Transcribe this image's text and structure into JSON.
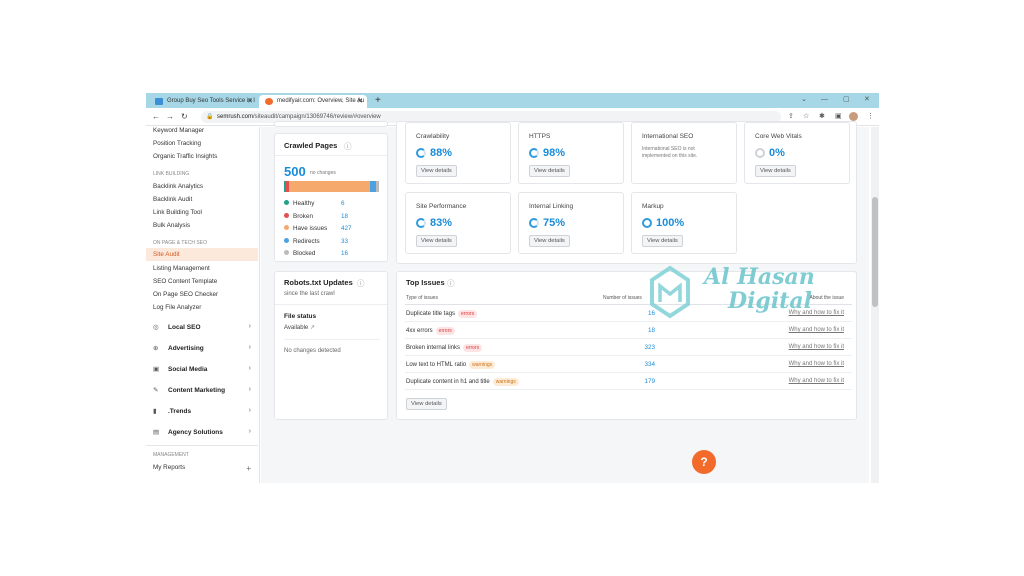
{
  "browser": {
    "tabs": [
      {
        "label": "Group Buy Seo Tools Service in I",
        "close": "✕"
      },
      {
        "label": "medifyair.com: Overview, Site Au",
        "close": "✕"
      }
    ],
    "new_tab": "+",
    "url_domain": "semrush.com",
    "url_path": "/siteaudit/campaign/13069746/review/#overview",
    "window_controls": [
      "⌄",
      "—",
      "▢",
      "✕"
    ]
  },
  "sidebar": {
    "top_items": [
      "Keyword Manager",
      "Position Tracking",
      "Organic Traffic Insights"
    ],
    "link_building_heading": "LINK BUILDING",
    "link_building_items": [
      "Backlink Analytics",
      "Backlink Audit",
      "Link Building Tool",
      "Bulk Analysis"
    ],
    "onpage_heading": "ON PAGE & TECH SEO",
    "onpage_items": [
      "Site Audit",
      "Listing Management",
      "SEO Content Template",
      "On Page SEO Checker",
      "Log File Analyzer"
    ],
    "groups": [
      {
        "label": "Local SEO",
        "icon": "pin-icon"
      },
      {
        "label": "Advertising",
        "icon": "target-icon"
      },
      {
        "label": "Social Media",
        "icon": "social-icon"
      },
      {
        "label": "Content Marketing",
        "icon": "pen-icon"
      },
      {
        "label": ".Trends",
        "icon": "bars-icon"
      },
      {
        "label": "Agency Solutions",
        "icon": "doc-icon"
      }
    ],
    "management_heading": "MANAGEMENT",
    "my_reports": "My Reports",
    "my_reports_add": "+"
  },
  "crawled": {
    "title": "Crawled Pages",
    "count": "500",
    "count_note": "no changes",
    "legend": [
      {
        "label": "Healthy",
        "value": "6",
        "color": "#23a08c"
      },
      {
        "label": "Broken",
        "value": "18",
        "color": "#e25050"
      },
      {
        "label": "Have issues",
        "value": "427",
        "color": "#f6a96c"
      },
      {
        "label": "Redirects",
        "value": "33",
        "color": "#4aa3e0"
      },
      {
        "label": "Blocked",
        "value": "16",
        "color": "#bbbbbb"
      }
    ]
  },
  "robots": {
    "title": "Robots.txt Updates",
    "subtitle": "since the last crawl",
    "file_status_label": "File status",
    "file_status_value": "Available",
    "changes": "No changes detected"
  },
  "metrics": [
    {
      "title": "Crawlability",
      "value": "88%",
      "button": "View details",
      "progress": 0.88
    },
    {
      "title": "HTTPS",
      "value": "98%",
      "button": "View details",
      "progress": 0.98
    },
    {
      "title": "International SEO",
      "note": "International SEO is not implemented on this site."
    },
    {
      "title": "Core Web Vitals",
      "value": "0%",
      "button": "View details",
      "progress": 0
    },
    {
      "title": "Site Performance",
      "value": "83%",
      "button": "View details",
      "progress": 0.83
    },
    {
      "title": "Internal Linking",
      "value": "75%",
      "button": "View details",
      "progress": 0.75
    },
    {
      "title": "Markup",
      "value": "100%",
      "button": "View details",
      "progress": 1.0
    }
  ],
  "top_issues": {
    "title": "Top Issues",
    "col_type": "Type of issues",
    "col_number": "Number of issues",
    "col_about": "About the issue",
    "rows": [
      {
        "text": "Duplicate title tags",
        "badge": "errors",
        "kind": "err",
        "count": "16",
        "link": "Why and how to fix it"
      },
      {
        "text": "4xx errors",
        "badge": "errors",
        "kind": "err",
        "count": "18",
        "link": "Why and how to fix it"
      },
      {
        "text": "Broken internal links",
        "badge": "errors",
        "kind": "err",
        "count": "323",
        "link": "Why and how to fix it"
      },
      {
        "text": "Low text to HTML ratio",
        "badge": "warnings",
        "kind": "warn",
        "count": "334",
        "link": "Why and how to fix it"
      },
      {
        "text": "Duplicate content in h1 and title",
        "badge": "warnings",
        "kind": "warn",
        "count": "179",
        "link": "Why and how to fix it"
      }
    ],
    "button": "View details"
  },
  "help_label": "?",
  "watermark": {
    "line1": "Al Hasan",
    "line2": "Digital"
  },
  "colors": {
    "accent": "#1a8cd8",
    "brand_orange": "#f26b2a",
    "tab_bar": "#a6d7e6"
  }
}
